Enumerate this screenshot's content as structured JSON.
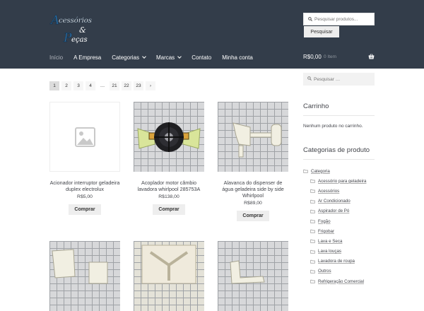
{
  "header": {
    "logo_alt": "Acessórios & Peças",
    "search_placeholder": "Pesquisar produtos...",
    "search_button": "Pesquisar"
  },
  "nav": {
    "items": [
      {
        "label": "Início",
        "current": true
      },
      {
        "label": "A Empresa"
      },
      {
        "label": "Categorias",
        "dropdown": true
      },
      {
        "label": "Marcas",
        "dropdown": true
      },
      {
        "label": "Contato"
      },
      {
        "label": "Minha conta"
      }
    ]
  },
  "cart": {
    "total": "R$0,00",
    "count": "0 Item",
    "icon": "basket-icon"
  },
  "pagination": {
    "pages": [
      "1",
      "2",
      "3",
      "4",
      "…",
      "21",
      "22",
      "23",
      "›"
    ],
    "current": "1"
  },
  "products": [
    {
      "title": "Acionador interruptor geladeira duplex electrolux",
      "price": "R$5,00",
      "button": "Comprar",
      "image": "placeholder"
    },
    {
      "title": "Acoplador motor câmbio lavadora whirlpool 285753A",
      "price": "R$138,00",
      "button": "Comprar",
      "image": "coupler"
    },
    {
      "title": "Alavanca do dispenser de água geladeira side by side Whirlpool",
      "price": "R$89,00",
      "button": "Comprar",
      "image": "lever"
    }
  ],
  "sidebar": {
    "search_placeholder": "Pesquisar …",
    "cart_title": "Carrinho",
    "cart_empty": "Nenhum produto no carrinho.",
    "categories_title": "Categorias de produto",
    "categories": [
      {
        "label": "Categoria",
        "level": 0
      },
      {
        "label": "Acessório para geladeira",
        "level": 1
      },
      {
        "label": "Acessórios",
        "level": 1
      },
      {
        "label": "Ar Condicionado",
        "level": 1
      },
      {
        "label": "Aspirador de Pó",
        "level": 1
      },
      {
        "label": "Fogão",
        "level": 1
      },
      {
        "label": "Frigobar",
        "level": 1
      },
      {
        "label": "Lava e Seca",
        "level": 1
      },
      {
        "label": "Lava louças",
        "level": 1
      },
      {
        "label": "Lavadora de roupa",
        "level": 1
      },
      {
        "label": "Outros",
        "level": 1
      },
      {
        "label": "Refrigeração Comercial",
        "level": 1
      }
    ]
  },
  "colors": {
    "header_bg": "#333d4a",
    "nav_text": "#ffffff",
    "muted": "#8f969e"
  }
}
